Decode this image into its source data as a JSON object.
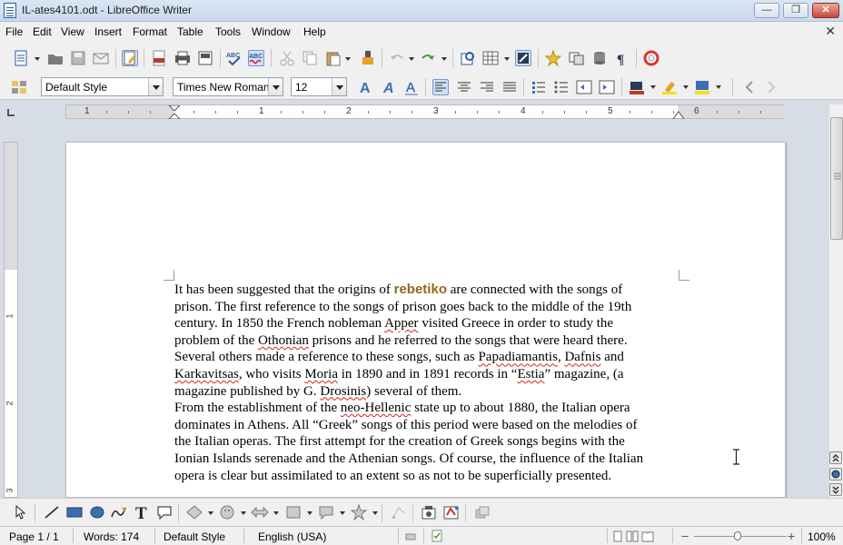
{
  "window": {
    "title": "IL-ates4101.odt - LibreOffice Writer",
    "minimize_label": "—",
    "maximize_label": "❐",
    "close_label": "✕"
  },
  "menubar": {
    "items": [
      {
        "label": "File"
      },
      {
        "label": "Edit"
      },
      {
        "label": "View"
      },
      {
        "label": "Insert"
      },
      {
        "label": "Format"
      },
      {
        "label": "Table"
      },
      {
        "label": "Tools"
      },
      {
        "label": "Window"
      },
      {
        "label": "Help"
      }
    ],
    "doc_close": "✕"
  },
  "formatting": {
    "paragraph_style": "Default Style",
    "font_name": "Times New Roman",
    "font_size": "12"
  },
  "ruler": {
    "numbers": [
      "1",
      "1",
      "2",
      "3",
      "4",
      "5",
      "6"
    ]
  },
  "vruler": {
    "numbers": [
      "1",
      "2",
      "3"
    ]
  },
  "document": {
    "lines": [
      [
        "It has been suggested that the origins of ",
        "<rebetiko>",
        " are connected with the songs of"
      ],
      [
        "prison. The first reference to the songs of prison goes back to the middle of the 19th"
      ],
      [
        "century. In 1850 the French nobleman ",
        "<sp:Apper>",
        " visited Greece in order to study the"
      ],
      [
        "problem of the ",
        "<sp:Othonian>",
        " prisons and he referred to the songs that were heard there."
      ],
      [
        "Several others made a reference to these songs, such as ",
        "<sp:Papadiamantis>",
        ", ",
        "<sp:Dafnis>",
        " and"
      ],
      [
        "<sp:Karkavitsas>",
        ", who visits ",
        "<sp:Moria>",
        " in 1890 and in 1891 records in “",
        "<sp:Estia>",
        "” magazine, (a"
      ],
      [
        "magazine published by G. ",
        "<sp:Drosinis>",
        ") several of them."
      ],
      [
        "From the establishment of the ",
        "<sp:neo-Hellenic>",
        " state up to about 1880, the Italian opera"
      ],
      [
        "dominates in Athens. All “Greek” songs of this period were based on the melodies of"
      ],
      [
        "the Italian operas. The first attempt for the creation of Greek songs begins with the"
      ],
      [
        "Ionian Islands serenade and the Athenian songs. Of course, the influence of the Italian"
      ],
      [
        "opera is clear but assimilated to an extent so as not to be superficially presented."
      ]
    ],
    "highlight_word": "rebetiko",
    "highlight_color": "#8e6a1c"
  },
  "statusbar": {
    "page": "Page 1 / 1",
    "words": "Words: 174",
    "style": "Default Style",
    "language": "English (USA)",
    "zoom": "100%"
  },
  "colors": {
    "accent": "#2b5aa0",
    "spell_underline": "#d42222"
  }
}
